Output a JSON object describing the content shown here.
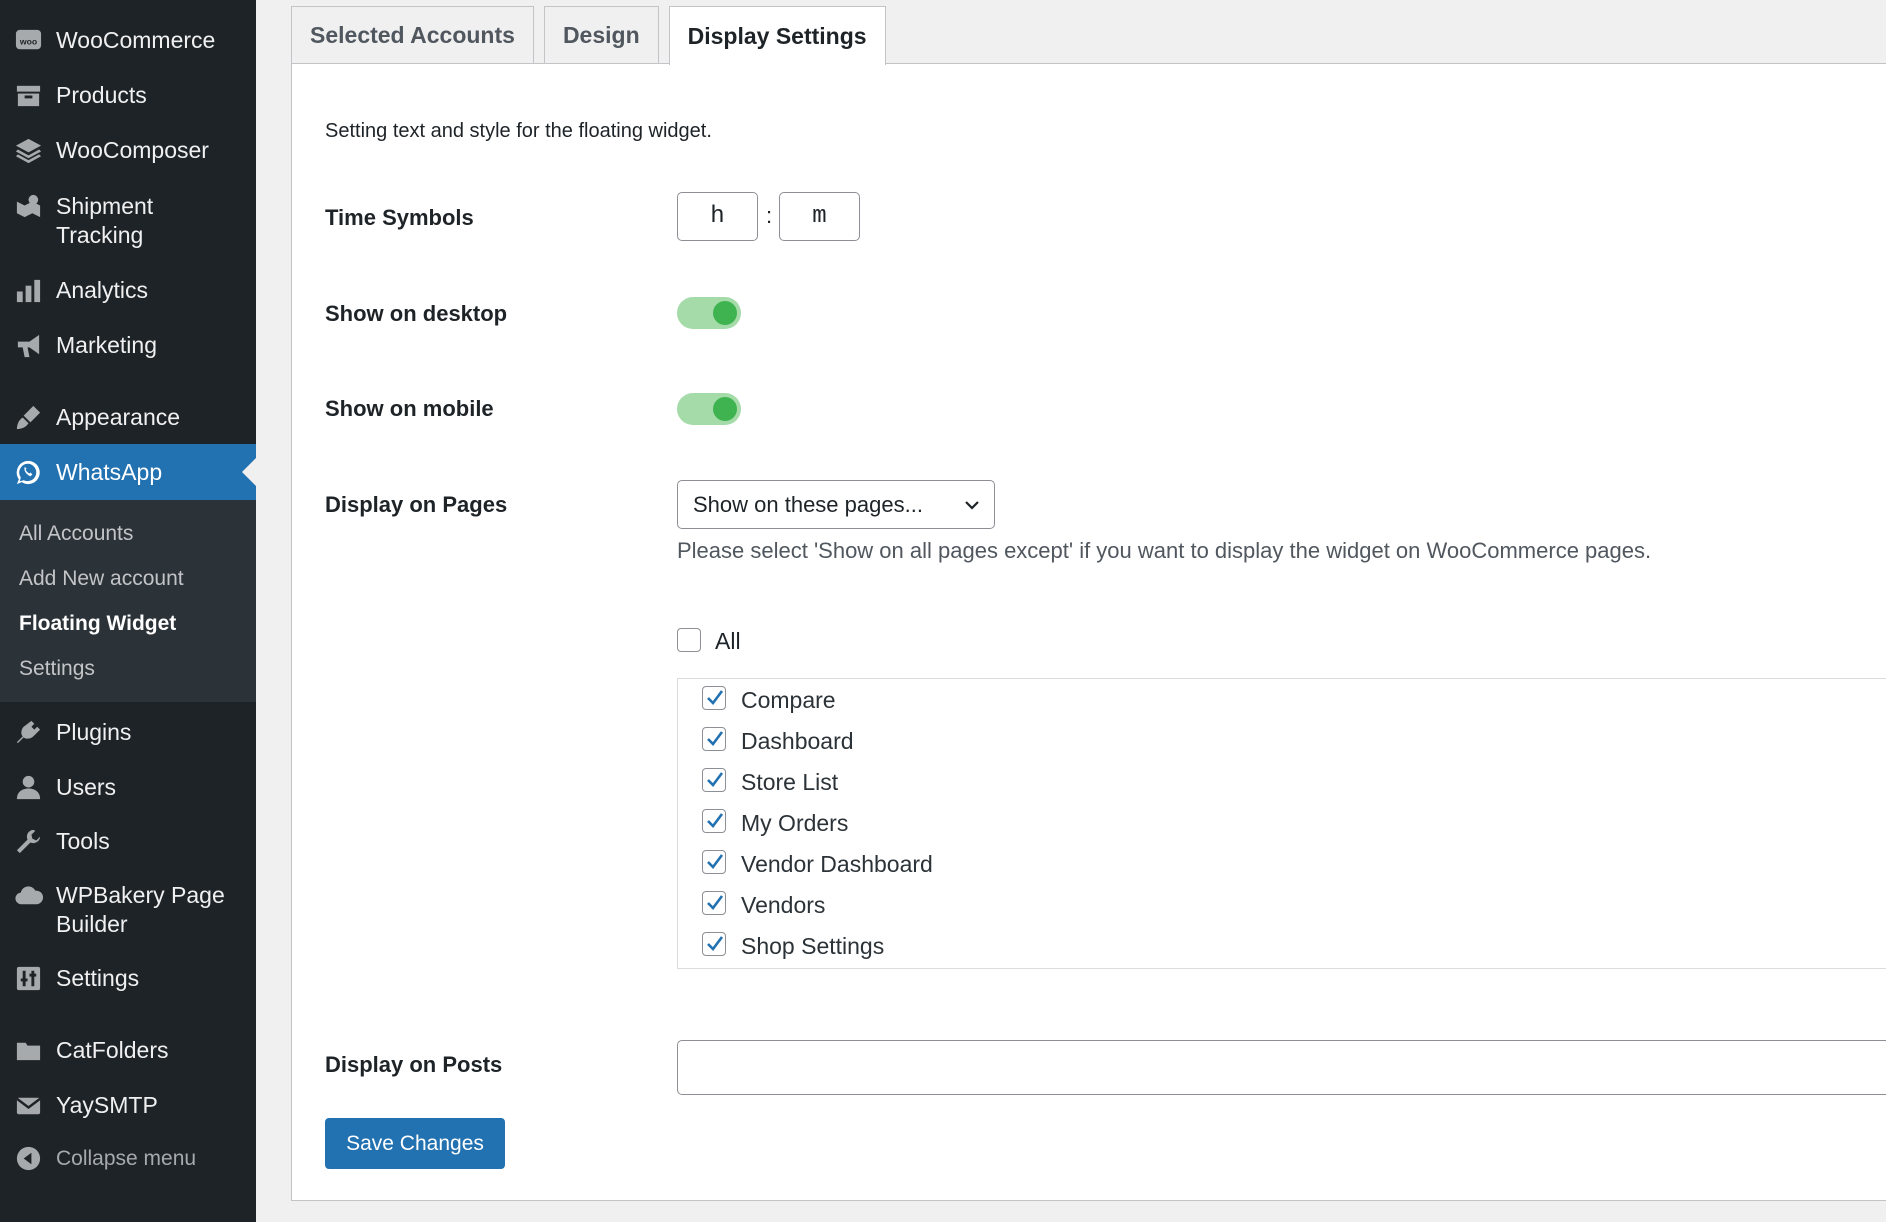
{
  "sidebar": {
    "items": [
      {
        "label": "WooCommerce",
        "icon": "woo-icon"
      },
      {
        "label": "Products",
        "icon": "archive-icon"
      },
      {
        "label": "WooComposer",
        "icon": "layers-icon"
      },
      {
        "label": "Shipment\nTracking",
        "icon": "truck-icon"
      },
      {
        "label": "Analytics",
        "icon": "bar-chart-icon"
      },
      {
        "label": "Marketing",
        "icon": "megaphone-icon"
      },
      {
        "label": "Appearance",
        "icon": "paintbrush-icon"
      },
      {
        "label": "WhatsApp",
        "icon": "whatsapp-icon"
      },
      {
        "label": "Plugins",
        "icon": "plugin-icon"
      },
      {
        "label": "Users",
        "icon": "user-icon"
      },
      {
        "label": "Tools",
        "icon": "wrench-icon"
      },
      {
        "label": "WPBakery Page\nBuilder",
        "icon": "cloud-icon"
      },
      {
        "label": "Settings",
        "icon": "sliders-icon"
      },
      {
        "label": "CatFolders",
        "icon": "folder-icon"
      },
      {
        "label": "YaySMTP",
        "icon": "envelope-icon"
      }
    ],
    "submenu": [
      "All Accounts",
      "Add New account",
      "Floating Widget",
      "Settings"
    ],
    "collapse_label": "Collapse menu"
  },
  "tabs": [
    "Selected Accounts",
    "Design",
    "Display Settings"
  ],
  "active_tab": "Display Settings",
  "form": {
    "intro": "Setting text and style for the floating widget.",
    "time_symbols_label": "Time Symbols",
    "time_hour": "h",
    "time_separator": ":",
    "time_minute": "m",
    "show_desktop_label": "Show on desktop",
    "show_desktop_on": true,
    "show_mobile_label": "Show on mobile",
    "show_mobile_on": true,
    "display_pages_label": "Display on Pages",
    "display_pages_selected": "Show on these pages...",
    "display_pages_hint": "Please select 'Show on all pages except' if you want to display the widget on WooCommerce pages.",
    "all_label": "All",
    "all_checked": false,
    "pages": [
      {
        "name": "Compare",
        "checked": true
      },
      {
        "name": "Dashboard",
        "checked": true
      },
      {
        "name": "Store List",
        "checked": true
      },
      {
        "name": "My Orders",
        "checked": true
      },
      {
        "name": "Vendor Dashboard",
        "checked": true
      },
      {
        "name": "Vendors",
        "checked": true
      },
      {
        "name": "Shop Settings",
        "checked": true
      }
    ],
    "display_posts_label": "Display on Posts",
    "display_posts_value": "",
    "save_label": "Save Changes"
  },
  "colors": {
    "sidebar_bg": "#1d2327",
    "accent": "#2271b1",
    "toggle_on": "#3fb34f"
  }
}
